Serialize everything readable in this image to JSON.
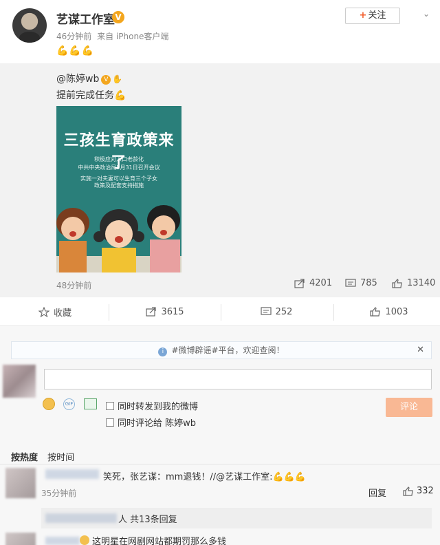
{
  "post": {
    "author": "艺谋工作室",
    "time": "46分钟前",
    "source": "来自 iPhone客户端",
    "emoji": "💪💪💪",
    "follow_label": "关注",
    "follow_plus": "+"
  },
  "repost": {
    "user": "@陈婷wb",
    "text": "提前完成任务",
    "emoji": "💪",
    "poster": {
      "title": "三孩生育政策来了",
      "line1": "积极应对人口老龄化",
      "line2": "中共中央政治局5月31日召开会议",
      "line3": "实施一对夫妻可以生育三个子女",
      "line4": "政策及配套支持措施"
    },
    "time": "48分钟前",
    "shares": "4201",
    "comments": "785",
    "likes": "13140"
  },
  "actions": {
    "favorite": "收藏",
    "share": "3615",
    "comment": "252",
    "like": "1003"
  },
  "comments_panel": {
    "notice": "#微博辟谣#平台，欢迎查阅！",
    "input_placeholder": "",
    "option_repost": "同时转发到我的微博",
    "option_comment": "同时评论给 陈婷wb",
    "submit_label": "评论",
    "sort_hot": "按热度",
    "sort_time": "按时间"
  },
  "comment_list": [
    {
      "text": "笑死，张艺谋：mm退钱！//@艺谋工作室:",
      "emoji": "💪💪💪",
      "time": "35分钟前",
      "reply_label": "回复",
      "likes": "332",
      "replies_summary": "人 共13条回复"
    },
    {
      "text": "这明星在网剧网站都期罚那么多钱"
    }
  ],
  "colors": {
    "accent": "#f25b29",
    "poster_bg": "#2a7f7a",
    "submit_bg": "#f9b894"
  }
}
